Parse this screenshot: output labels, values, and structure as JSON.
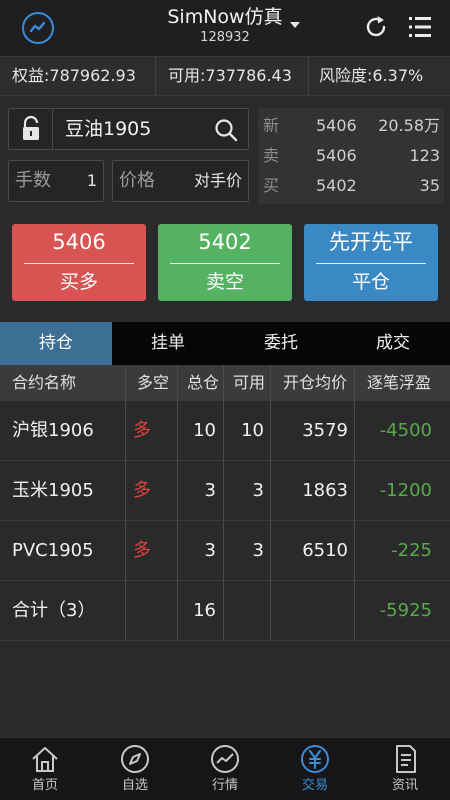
{
  "header": {
    "title": "SimNow仿真",
    "account_id": "128932"
  },
  "account": {
    "equity": "权益:787962.93",
    "available": "可用:737786.43",
    "risk": "风险度:6.37%"
  },
  "order": {
    "symbol": "豆油1905",
    "qty_label": "手数",
    "qty_value": "1",
    "price_label": "价格",
    "price_value": "对手价"
  },
  "quote": {
    "rows": [
      {
        "label": "新",
        "price": "5406",
        "vol": "20.58万"
      },
      {
        "label": "卖",
        "price": "5406",
        "vol": "123"
      },
      {
        "label": "买",
        "price": "5402",
        "vol": "35"
      }
    ]
  },
  "buttons": {
    "buy": {
      "price": "5406",
      "label": "买多"
    },
    "sell": {
      "price": "5402",
      "label": "卖空"
    },
    "close": {
      "top": "先开先平",
      "label": "平仓"
    }
  },
  "tabs": [
    "持仓",
    "挂单",
    "委托",
    "成交"
  ],
  "table": {
    "headers": [
      "合约名称",
      "多空",
      "总仓",
      "可用",
      "开仓均价",
      "逐笔浮盈"
    ],
    "rows": [
      {
        "name": "沪银1906",
        "dir": "多",
        "total": "10",
        "avail": "10",
        "avg": "3579",
        "pnl": "-4500"
      },
      {
        "name": "玉米1905",
        "dir": "多",
        "total": "3",
        "avail": "3",
        "avg": "1863",
        "pnl": "-1200"
      },
      {
        "name": "PVC1905",
        "dir": "多",
        "total": "3",
        "avail": "3",
        "avg": "6510",
        "pnl": "-225"
      }
    ],
    "total_row": {
      "name": "合计（3）",
      "total": "16",
      "pnl": "-5925"
    }
  },
  "nav": [
    {
      "label": "首页",
      "icon": "home-icon"
    },
    {
      "label": "自选",
      "icon": "compass-icon"
    },
    {
      "label": "行情",
      "icon": "chart-icon"
    },
    {
      "label": "交易",
      "icon": "yen-icon"
    },
    {
      "label": "资讯",
      "icon": "document-icon"
    }
  ],
  "colors": {
    "accent": "#3a8cd8",
    "buy": "#d85452",
    "sell": "#55b262",
    "close": "#3a88c4",
    "loss_text": "#5aa84a",
    "long_text": "#e0443d"
  }
}
